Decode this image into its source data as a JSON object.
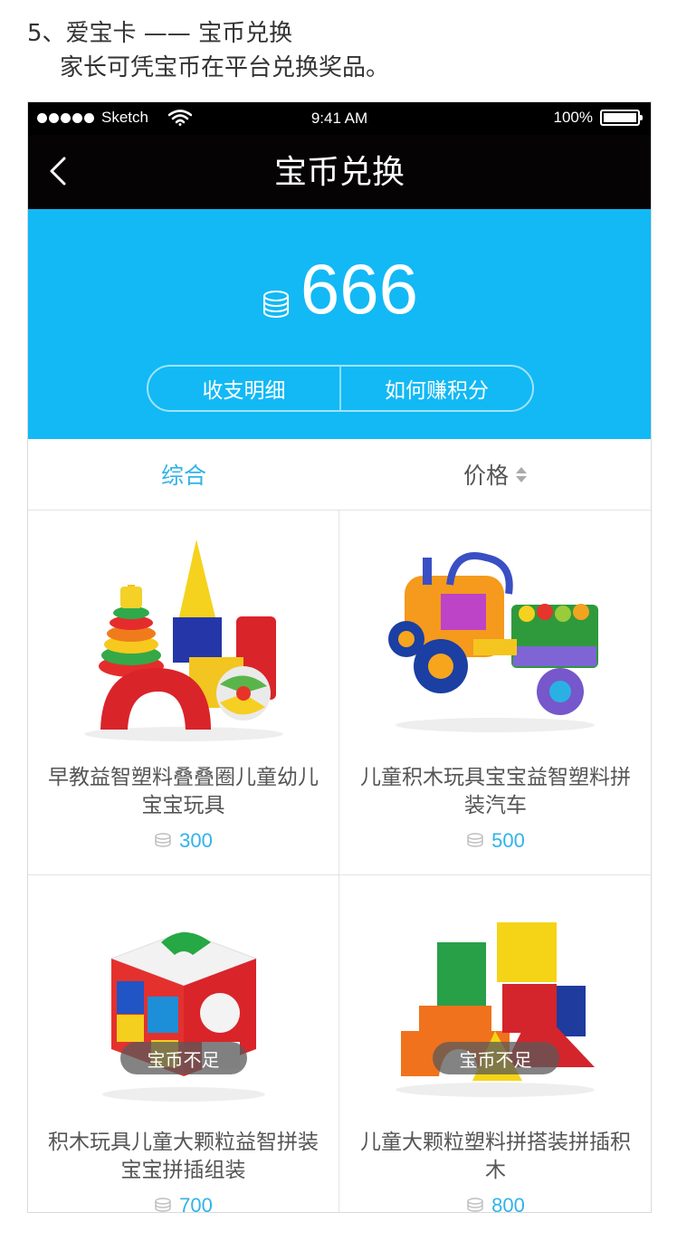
{
  "intro": {
    "line1": "5、爱宝卡 —— 宝币兑换",
    "line2": "家长可凭宝币在平台兑换奖品。"
  },
  "statusbar": {
    "carrier": "Sketch",
    "time": "9:41 AM",
    "battery": "100%"
  },
  "nav": {
    "title": "宝币兑换",
    "back_icon": "chevron-left-icon"
  },
  "balance": {
    "value": "666",
    "icon": "coin-stack-icon",
    "actions": [
      "收支明细",
      "如何赚积分"
    ]
  },
  "sort": {
    "options": [
      "综合",
      "价格"
    ],
    "active": "综合"
  },
  "colors": {
    "accent": "#30b3e8",
    "hero_bg": "#12b9f5",
    "navbar_bg": "#050304"
  },
  "products": [
    {
      "name": "早教益智塑料叠叠圈儿童幼儿宝宝玩具",
      "price": "300",
      "badge": ""
    },
    {
      "name": "儿童积木玩具宝宝益智塑料拼装汽车",
      "price": "500",
      "badge": ""
    },
    {
      "name": "积木玩具儿童大颗粒益智拼装宝宝拼插组装",
      "price": "700",
      "badge": "宝币不足"
    },
    {
      "name": "儿童大颗粒塑料拼搭装拼插积木",
      "price": "800",
      "badge": "宝币不足"
    }
  ]
}
